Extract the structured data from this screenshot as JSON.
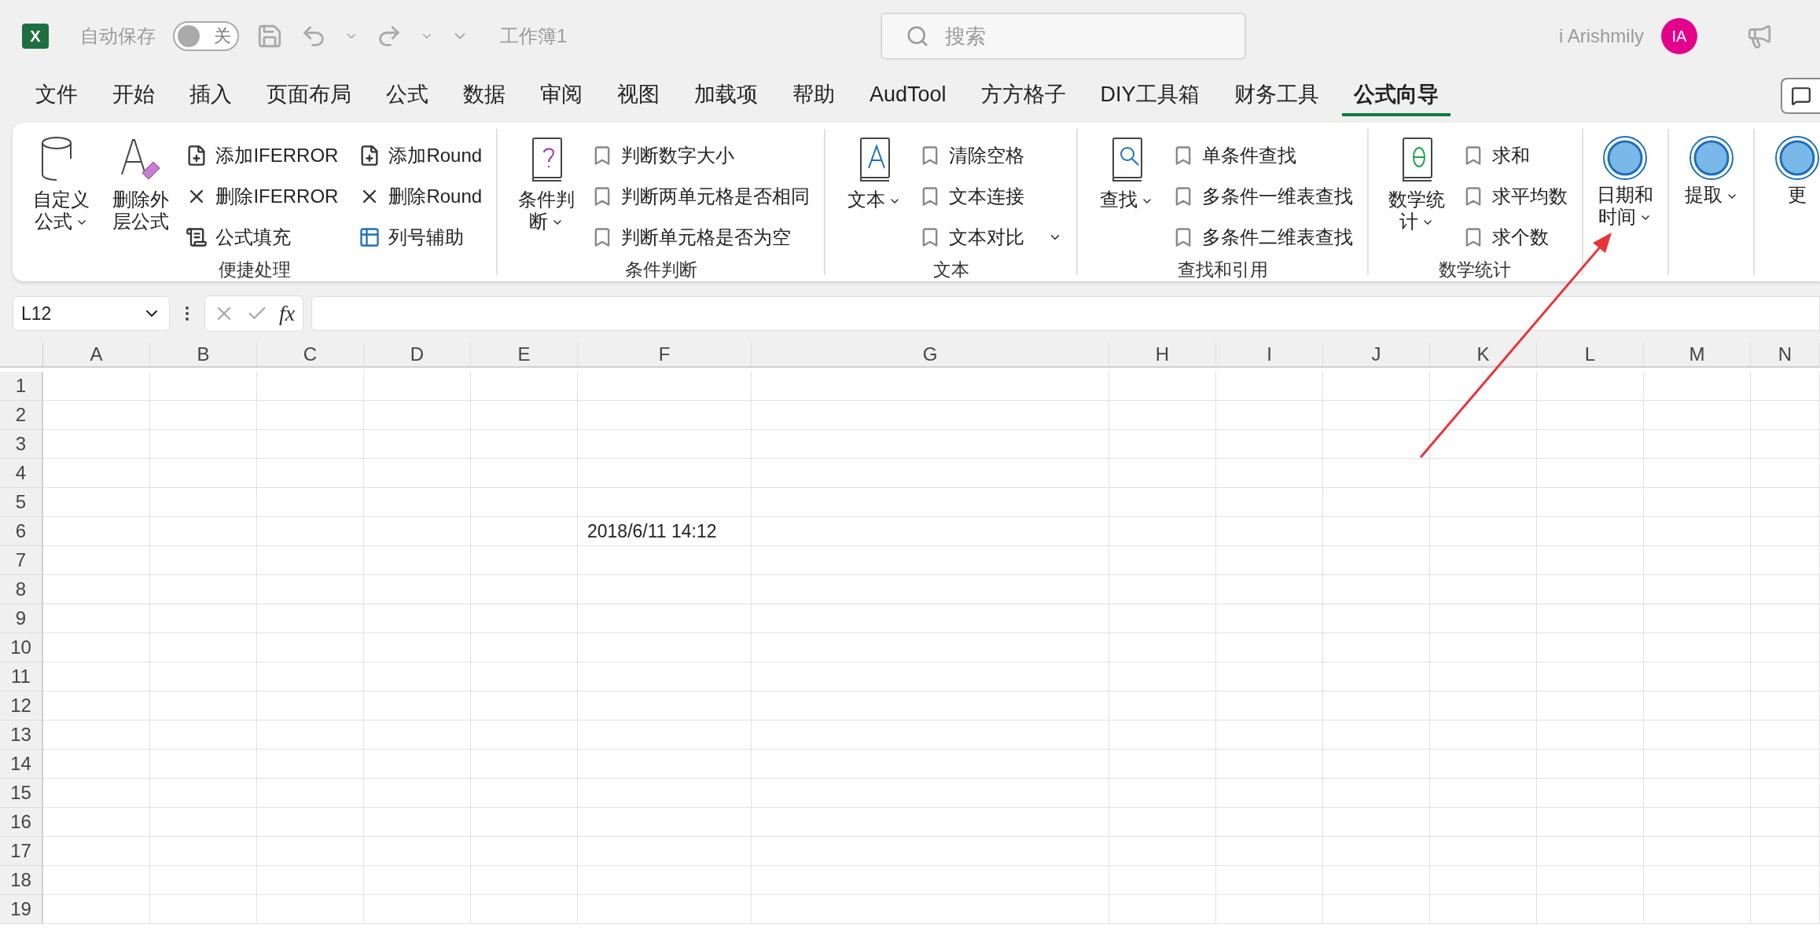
{
  "title_bar": {
    "logo_letter": "X",
    "autosave_label": "自动保存",
    "autosave_toggle": {
      "label": "关",
      "on": false
    },
    "workbook": "工作簿1",
    "search_placeholder": "搜索",
    "user": "i Arishmily",
    "avatar": "IA"
  },
  "menu_tabs": [
    {
      "label": "文件",
      "selected": false
    },
    {
      "label": "开始",
      "selected": false
    },
    {
      "label": "插入",
      "selected": false
    },
    {
      "label": "页面布局",
      "selected": false
    },
    {
      "label": "公式",
      "selected": false
    },
    {
      "label": "数据",
      "selected": false
    },
    {
      "label": "审阅",
      "selected": false
    },
    {
      "label": "视图",
      "selected": false
    },
    {
      "label": "加载项",
      "selected": false
    },
    {
      "label": "帮助",
      "selected": false
    },
    {
      "label": "AudTool",
      "selected": false
    },
    {
      "label": "方方格子",
      "selected": false
    },
    {
      "label": "DIY工具箱",
      "selected": false
    },
    {
      "label": "财务工具",
      "selected": false
    },
    {
      "label": "公式向导",
      "selected": true
    }
  ],
  "ribbon": {
    "groups": [
      {
        "label": "便捷处理",
        "large": [
          {
            "label": "自定义公式",
            "dropdown": true
          },
          {
            "label": "删除外层公式",
            "dropdown": false
          }
        ],
        "small": [
          {
            "label": "添加IFERROR",
            "dropdown": false
          },
          {
            "label": "删除IFERROR",
            "dropdown": false
          },
          {
            "label": "公式填充",
            "dropdown": false
          },
          {
            "label": "添加Round",
            "dropdown": false
          },
          {
            "label": "删除Round",
            "dropdown": false
          },
          {
            "label": "列号辅助",
            "dropdown": false
          }
        ]
      },
      {
        "label": "条件判断",
        "large": [
          {
            "label": "条件判断",
            "dropdown": true
          }
        ],
        "small": [
          {
            "label": "判断数字大小",
            "dropdown": false
          },
          {
            "label": "判断两单元格是否相同",
            "dropdown": false
          },
          {
            "label": "判断单元格是否为空",
            "dropdown": false
          }
        ]
      },
      {
        "label": "文本",
        "large": [
          {
            "label": "文本",
            "dropdown": true
          }
        ],
        "small": [
          {
            "label": "清除空格",
            "dropdown": false
          },
          {
            "label": "文本连接",
            "dropdown": false
          },
          {
            "label": "文本对比",
            "dropdown": true
          }
        ]
      },
      {
        "label": "查找和引用",
        "large": [
          {
            "label": "查找",
            "dropdown": true
          }
        ],
        "small": [
          {
            "label": "单条件查找",
            "dropdown": false
          },
          {
            "label": "多条件一维表查找",
            "dropdown": false
          },
          {
            "label": "多条件二维表查找",
            "dropdown": false
          }
        ]
      },
      {
        "label": "数学统计",
        "large": [
          {
            "label": "数学统计",
            "dropdown": true
          }
        ],
        "small": [
          {
            "label": "求和",
            "dropdown": false
          },
          {
            "label": "求平均数",
            "dropdown": false
          },
          {
            "label": "求个数",
            "dropdown": false
          }
        ]
      },
      {
        "large": [
          {
            "label": "日期和时间",
            "dropdown": true
          }
        ]
      },
      {
        "large": [
          {
            "label": "提取",
            "dropdown": true
          }
        ]
      },
      {
        "large": [
          {
            "label": "更",
            "dropdown": false
          }
        ]
      }
    ]
  },
  "formula_bar": {
    "name_box": "L12",
    "fx": "fx"
  },
  "sheet": {
    "columns": [
      "A",
      "B",
      "C",
      "D",
      "E",
      "F",
      "G",
      "H",
      "I",
      "J",
      "K",
      "L",
      "M",
      "N"
    ],
    "rows": [
      {
        "label": "1"
      },
      {
        "label": "2"
      },
      {
        "label": "3"
      },
      {
        "label": "4"
      },
      {
        "label": "5"
      },
      {
        "label": "6",
        "cells": [
          null,
          null,
          null,
          null,
          null,
          "2018/6/11 14:12"
        ]
      },
      {
        "label": "7"
      },
      {
        "label": "8"
      },
      {
        "label": "9"
      },
      {
        "label": "10"
      },
      {
        "label": "11"
      },
      {
        "label": "12"
      },
      {
        "label": "13"
      },
      {
        "label": "14"
      },
      {
        "label": "15"
      },
      {
        "label": "16"
      },
      {
        "label": "17"
      },
      {
        "label": "18"
      },
      {
        "label": "19"
      }
    ]
  }
}
